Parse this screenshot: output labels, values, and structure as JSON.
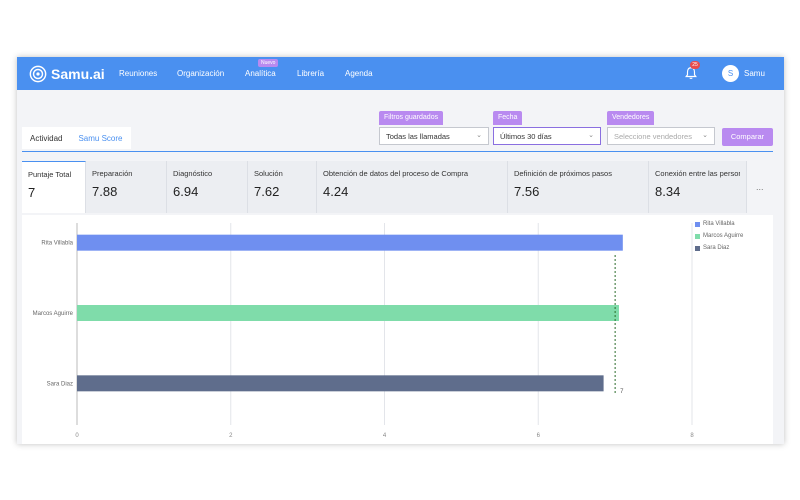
{
  "app": {
    "name": "Samu.ai",
    "nav": [
      "Reuniones",
      "Organización",
      "Analítica",
      "Librería",
      "Agenda"
    ],
    "new_badge": "Nuevo",
    "notification_count": "25",
    "user": {
      "initial": "S",
      "name": "Samu"
    }
  },
  "tabs": [
    {
      "label": "Actividad",
      "active": false
    },
    {
      "label": "Samu Score",
      "active": true
    }
  ],
  "filters": {
    "saved": {
      "label": "Filtros guardados",
      "value": "Todas las llamadas"
    },
    "date": {
      "label": "Fecha",
      "value": "Últimos 30 días"
    },
    "sellers": {
      "label": "Vendedores",
      "placeholder": "Seleccione vendedores"
    },
    "compare_button": "Comparar"
  },
  "score_cards": [
    {
      "label": "Puntaje Total",
      "value": "7",
      "active": true
    },
    {
      "label": "Preparación",
      "value": "7.88"
    },
    {
      "label": "Diagnóstico",
      "value": "6.94"
    },
    {
      "label": "Solución",
      "value": "7.62"
    },
    {
      "label": "Obtención de datos del proceso de Compra",
      "value": "4.24"
    },
    {
      "label": "Definición de próximos pasos",
      "value": "7.56"
    },
    {
      "label": "Conexión entre las persor",
      "value": "8.34"
    }
  ],
  "more_label": "...",
  "chart_data": {
    "type": "bar",
    "orientation": "horizontal",
    "categories": [
      "Rita Villabla",
      "Marcos Aguirre",
      "Sara Diaz"
    ],
    "values": [
      7.1,
      7.05,
      6.85
    ],
    "colors": [
      "#6f8ff0",
      "#7fdcaa",
      "#5f6d8c"
    ],
    "xlim": [
      0,
      8
    ],
    "xticks": [
      0,
      2,
      4,
      6,
      8
    ],
    "reference_line": {
      "value": 7,
      "label": "7",
      "color": "#2a6b2a"
    },
    "legend": [
      "Rita Villabla",
      "Marcos Aguirre",
      "Sara Diaz"
    ],
    "legend_position": "top-right",
    "grid": true
  },
  "colors": {
    "topbar": "#4a90f0",
    "accent": "#b98af0",
    "badge": "#e94b4b"
  }
}
